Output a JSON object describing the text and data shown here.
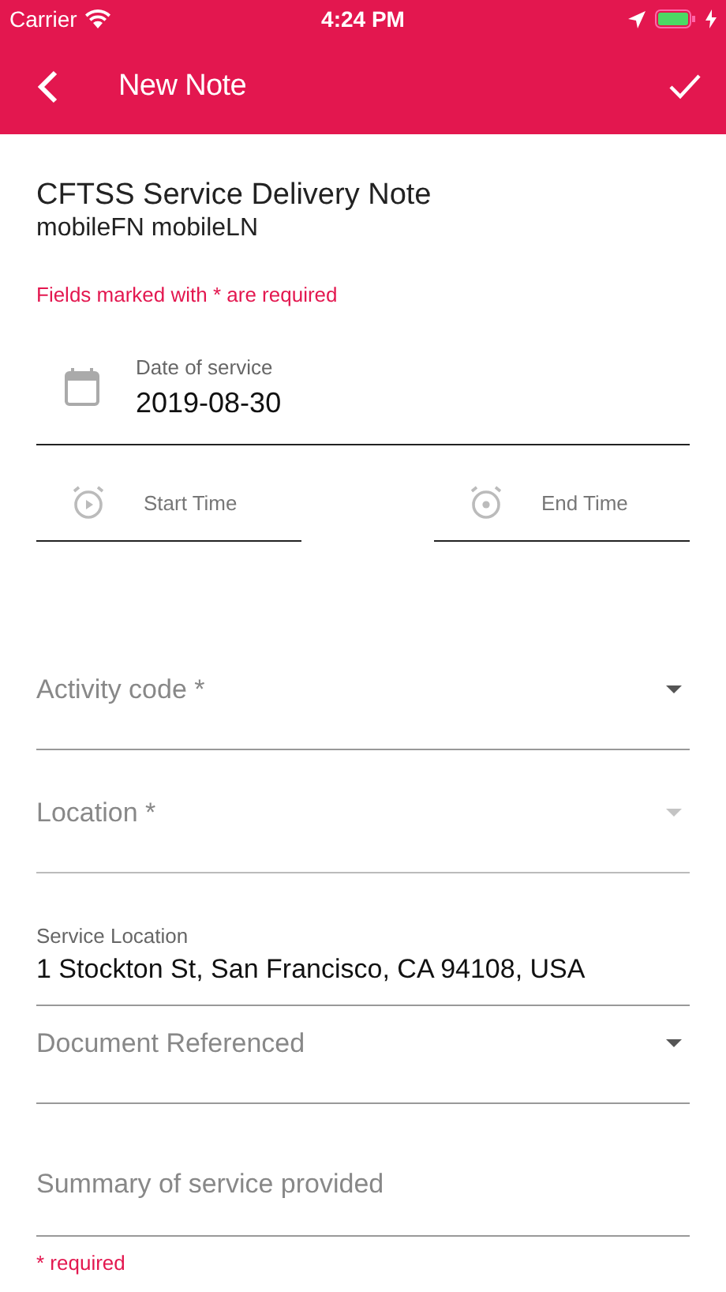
{
  "status_bar": {
    "carrier": "Carrier",
    "time": "4:24 PM"
  },
  "app_bar": {
    "title": "New Note"
  },
  "form": {
    "title": "CFTSS Service Delivery Note",
    "subtitle": "mobileFN mobileLN",
    "hint": "Fields marked with * are required",
    "date": {
      "label": "Date of service",
      "value": "2019-08-30"
    },
    "times": [
      {
        "placeholder": "Start Time"
      },
      {
        "placeholder": "End Time"
      }
    ],
    "fields": [
      {
        "kind": "select",
        "placeholder": "Activity code *",
        "disabled": false
      },
      {
        "kind": "select",
        "placeholder": "Location *",
        "disabled": true
      },
      {
        "kind": "text",
        "label": "Service Location",
        "value": "1 Stockton St, San Francisco, CA 94108, USA"
      },
      {
        "kind": "select",
        "placeholder": "Document Referenced",
        "disabled": false
      },
      {
        "kind": "textarea",
        "placeholder": "Summary of service provided",
        "error": "* required"
      }
    ]
  }
}
